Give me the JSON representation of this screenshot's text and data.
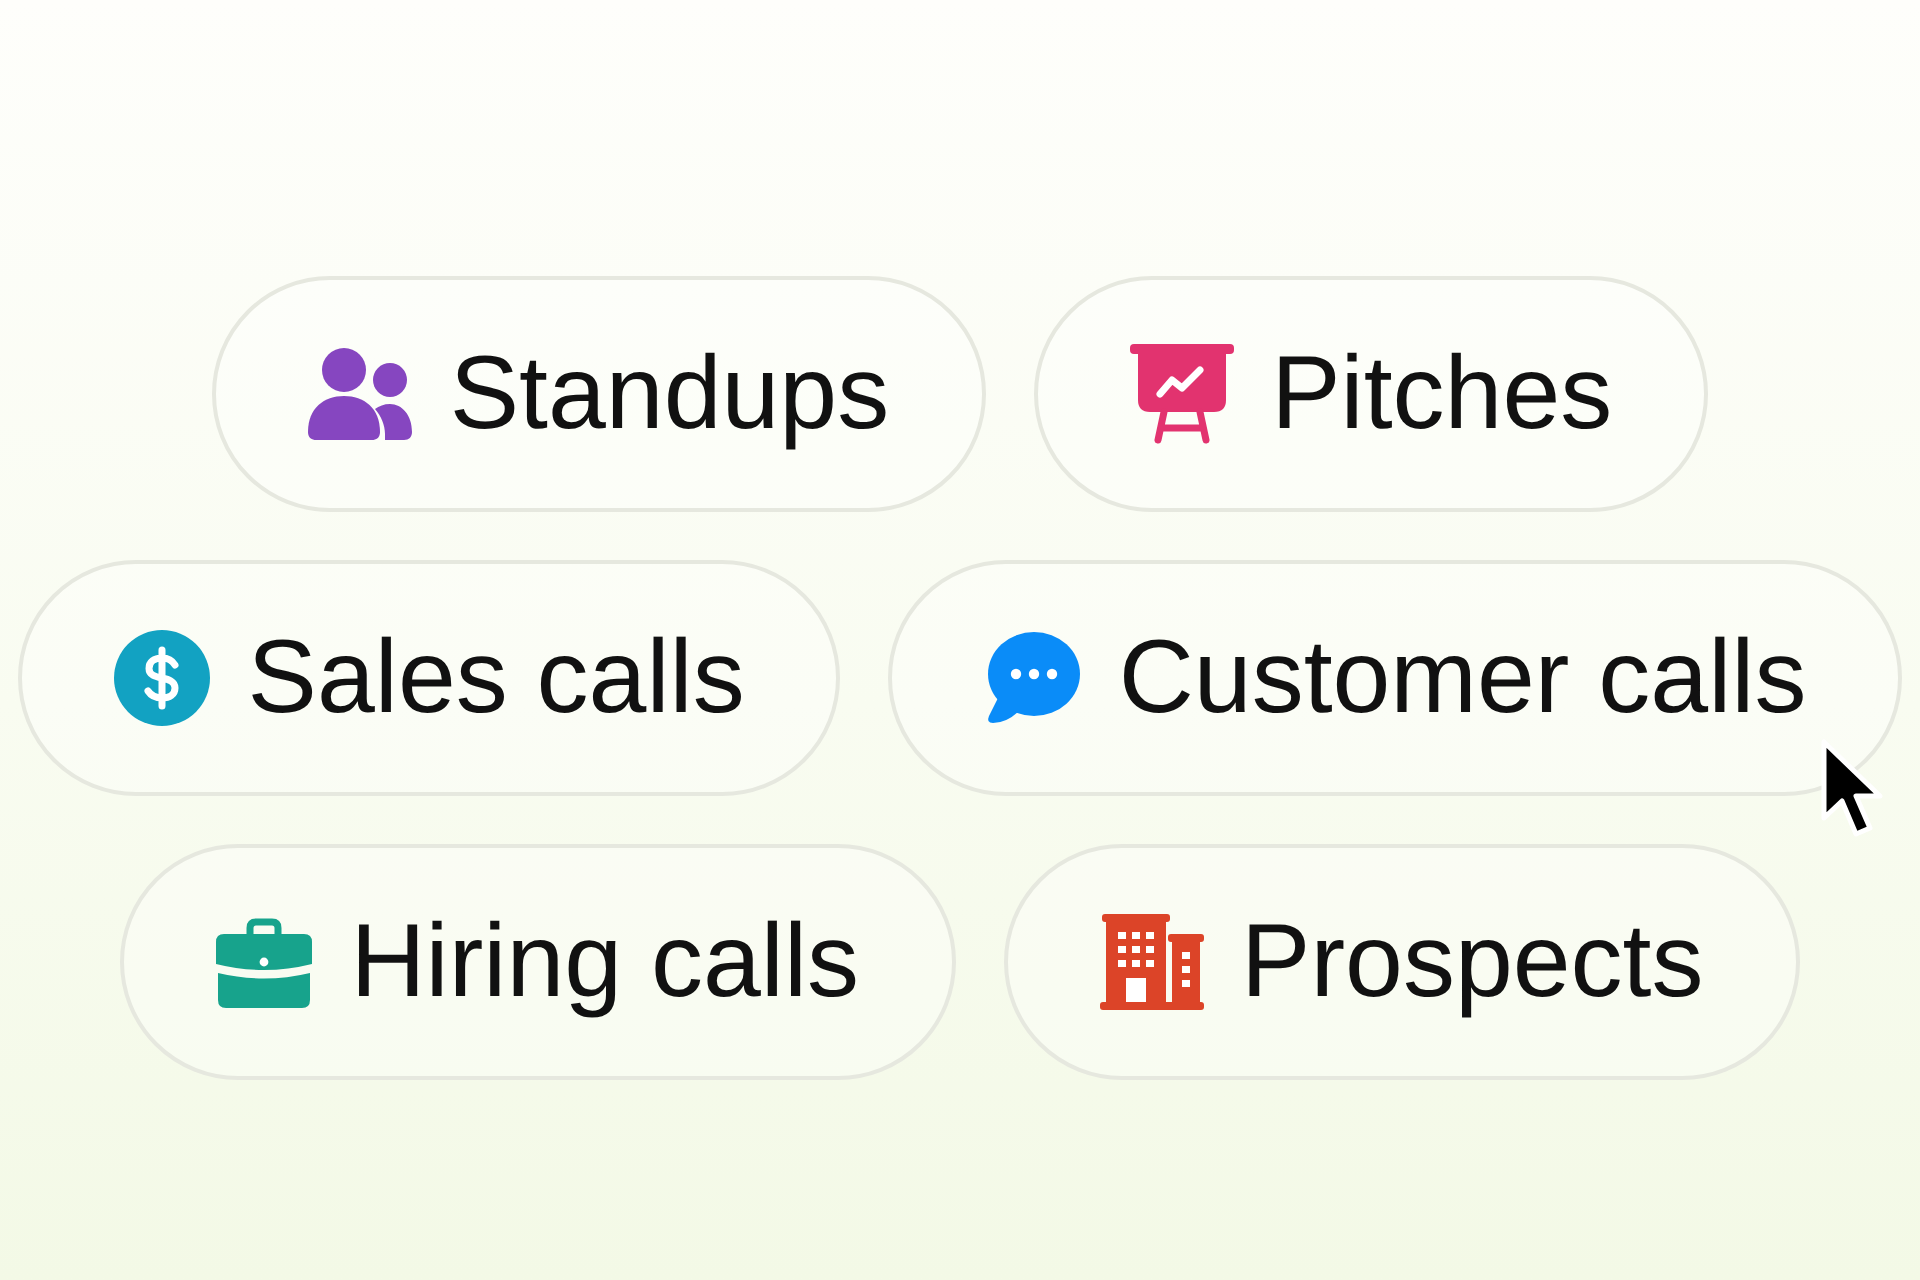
{
  "rows": [
    {
      "chips": [
        {
          "label": "Standups"
        },
        {
          "label": "Pitches"
        }
      ]
    },
    {
      "chips": [
        {
          "label": "Sales calls"
        },
        {
          "label": "Customer calls"
        }
      ]
    },
    {
      "chips": [
        {
          "label": "Hiring calls"
        },
        {
          "label": "Prospects"
        }
      ]
    }
  ]
}
